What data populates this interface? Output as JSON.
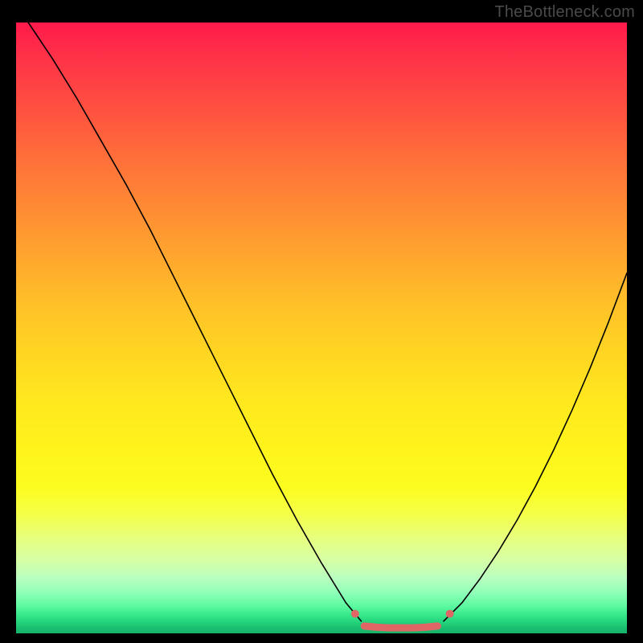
{
  "watermark": "TheBottleneck.com",
  "chart_data": {
    "type": "line",
    "title": "",
    "xlabel": "",
    "ylabel": "",
    "xlim": [
      0,
      100
    ],
    "ylim": [
      0,
      100
    ],
    "series": [
      {
        "name": "curve-left",
        "x": [
          2,
          6,
          10,
          14,
          18,
          22,
          26,
          30,
          34,
          38,
          42,
          46,
          50,
          54,
          56.5
        ],
        "y": [
          100,
          94,
          87.5,
          80.5,
          73.5,
          66,
          58,
          50,
          42,
          34,
          26,
          18.5,
          11.5,
          5,
          2
        ],
        "stroke": "#000000",
        "width": 1.6
      },
      {
        "name": "curve-right",
        "x": [
          70,
          73,
          76,
          79,
          82,
          85,
          88,
          91,
          94,
          97,
          100
        ],
        "y": [
          2,
          5,
          9,
          13.5,
          18.5,
          24,
          30,
          36.5,
          43.5,
          51,
          59
        ],
        "stroke": "#000000",
        "width": 1.6
      },
      {
        "name": "flat-bottom",
        "x": [
          57,
          59,
          61,
          63,
          65,
          67,
          69
        ],
        "y": [
          1.2,
          1.0,
          0.9,
          0.9,
          0.9,
          1.0,
          1.2
        ],
        "stroke": "#e06666",
        "width": 9
      },
      {
        "name": "dot-left",
        "x": [
          55.5
        ],
        "y": [
          3.2
        ],
        "stroke": "#e06666",
        "width": 9
      },
      {
        "name": "dot-right",
        "x": [
          71
        ],
        "y": [
          3.2
        ],
        "stroke": "#e06666",
        "width": 9
      }
    ]
  },
  "colors": {
    "black": "#000000",
    "marker": "#e06666"
  }
}
